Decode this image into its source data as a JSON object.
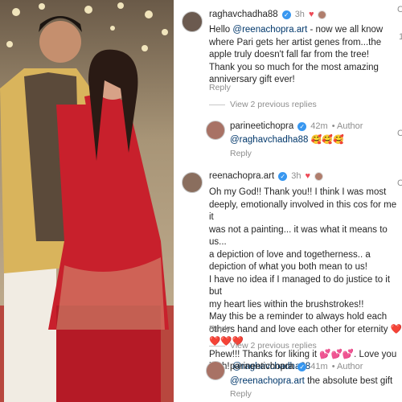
{
  "photo": {
    "alt_icon": "couple-photo"
  },
  "comments": [
    {
      "username": "raghavchadha88",
      "time": "3h",
      "text_parts": [
        "Hello ",
        "@reenachopra.art",
        " - now we all know where Pari gets her artist genes from...the apple truly doesn't fall far from the tree!",
        "Thank you so much for the most amazing anniversary gift ever!"
      ],
      "reply_label": "Reply",
      "view_replies": "View 2 previous replies"
    },
    {
      "username": "parineetichopra",
      "time": "42m",
      "author_label": "Author",
      "mention": "@raghavchadha88",
      "emojis": "🥰🥰🥰",
      "reply_label": "Reply"
    },
    {
      "username": "reenachopra.art",
      "time": "3h",
      "lines": [
        "Oh my God!! Thank you!! I think I was most",
        "deeply, emotionally involved in this cos for me it",
        "was not a painting... it was what it means to us...",
        "a depiction of love and togetherness.. a",
        "depiction of what you both mean to us!",
        "I have no idea if I managed to do justice to it but",
        "my heart lies within the brushstrokes!!",
        "May this be a reminder to always hold each",
        "others hand and love each other for eternity ❤️",
        "❤️❤️❤️",
        "Phew!!! Thanks for liking it 💕💕💕. Love you",
        "both! "
      ],
      "mention_end": "@raghavchadha88",
      "reply_label": "Reply",
      "view_replies": "View 2 previous replies"
    },
    {
      "username": "parineetichopra",
      "time": "41m",
      "author_label": "Author",
      "mention": "@reenachopra.art",
      "text": " the absolute best gift",
      "reply_label": "Reply"
    }
  ],
  "edge": {
    "c1": "C",
    "c2": "C",
    "c3": "C",
    "dot": "1"
  }
}
